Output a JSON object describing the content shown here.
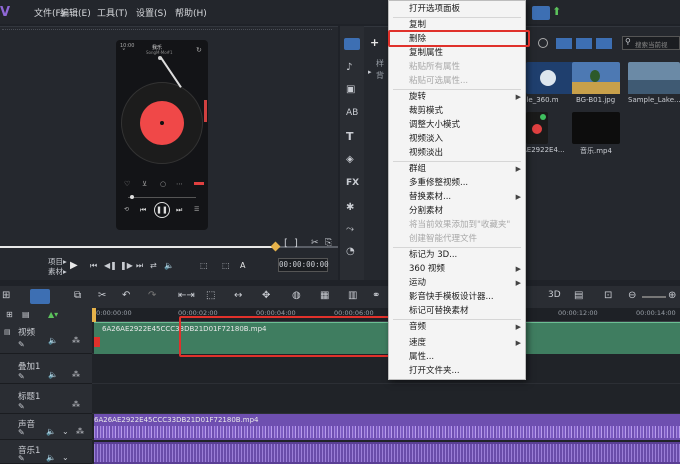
{
  "menubar": {
    "items": [
      "文件(F)",
      "编辑(E)",
      "工具(T)",
      "设置(S)",
      "帮助(H)"
    ]
  },
  "preview": {
    "project_label": "项目▸",
    "clip_label": "素材▸",
    "timecode": "00:00:00:00",
    "phone": {
      "time": "10:00",
      "title": "我乐",
      "subtitle": "SongM·Mo#1"
    }
  },
  "library": {
    "search_placeholder": "搜索当前视",
    "tree_item_1": "样",
    "tree_item_2": "背",
    "thumbnails": [
      {
        "label": "ple_360.m",
        "color": "#1f3f6e"
      },
      {
        "label": "BG-B01.jpg",
        "color": "#4d79b3"
      },
      {
        "label": "Sample_Lake...",
        "color": "#6b8aa6"
      },
      {
        "label": "AE2922E4...",
        "color": "#1a1a1a"
      },
      {
        "label": "音乐.mp4",
        "color": "#0d0d0d"
      }
    ]
  },
  "context_menu": {
    "items": [
      {
        "label": "打开选项面板",
        "disabled": false,
        "submenu": false
      },
      {
        "label": "复制",
        "disabled": false,
        "submenu": false
      },
      {
        "label": "删除",
        "disabled": false,
        "submenu": false
      },
      {
        "label": "复制属性",
        "disabled": false,
        "submenu": false
      },
      {
        "label": "粘贴所有属性",
        "disabled": true,
        "submenu": false
      },
      {
        "label": "粘贴可选属性...",
        "disabled": true,
        "submenu": false
      },
      {
        "label": "旋转",
        "disabled": false,
        "submenu": true
      },
      {
        "label": "裁剪模式",
        "disabled": false,
        "submenu": false
      },
      {
        "label": "调整大小模式",
        "disabled": false,
        "submenu": false
      },
      {
        "label": "视频淡入",
        "disabled": false,
        "submenu": false
      },
      {
        "label": "视频淡出",
        "disabled": false,
        "submenu": false
      },
      {
        "label": "群组",
        "disabled": false,
        "submenu": true
      },
      {
        "label": "多重修整视频...",
        "disabled": false,
        "submenu": false
      },
      {
        "label": "替换素材...",
        "disabled": false,
        "submenu": true
      },
      {
        "label": "分割素材",
        "disabled": false,
        "submenu": false
      },
      {
        "label": "将当前效果添加到\"收藏夹\"",
        "disabled": true,
        "submenu": false
      },
      {
        "label": "创建智能代理文件",
        "disabled": true,
        "submenu": false
      },
      {
        "label": "标记为 3D...",
        "disabled": false,
        "submenu": false
      },
      {
        "label": "360 视频",
        "disabled": false,
        "submenu": true
      },
      {
        "label": "运动",
        "disabled": false,
        "submenu": true
      },
      {
        "label": "影音快手模板设计器...",
        "disabled": false,
        "submenu": false
      },
      {
        "label": "标记可替换素材",
        "disabled": false,
        "submenu": false
      },
      {
        "label": "音频",
        "disabled": false,
        "submenu": true
      },
      {
        "label": "速度",
        "disabled": false,
        "submenu": true
      },
      {
        "label": "属性...",
        "disabled": false,
        "submenu": false
      },
      {
        "label": "打开文件夹...",
        "disabled": false,
        "submenu": false
      }
    ]
  },
  "timeline": {
    "ruler": [
      "00:00:00:00",
      "00:00:02:00",
      "00:00:04:00",
      "00:00:06:00",
      "00:00:12:00",
      "00:00:14:00"
    ],
    "tracks": [
      {
        "name": "视频"
      },
      {
        "name": "叠加1"
      },
      {
        "name": "标题1"
      },
      {
        "name": "声音"
      },
      {
        "name": "音乐1"
      }
    ],
    "video_clip": "6A26AE2922E45CCC33DB21D01F72180B.mp4",
    "audio_clip": "6A26AE2922E45CCC33DB21D01F72180B.mp4",
    "audio_clip_tail": "6A26AE"
  },
  "colors": {
    "accent_red": "#e0312b",
    "video_clip": "#3f7d60",
    "audio_clip": "#6e4fb0"
  }
}
